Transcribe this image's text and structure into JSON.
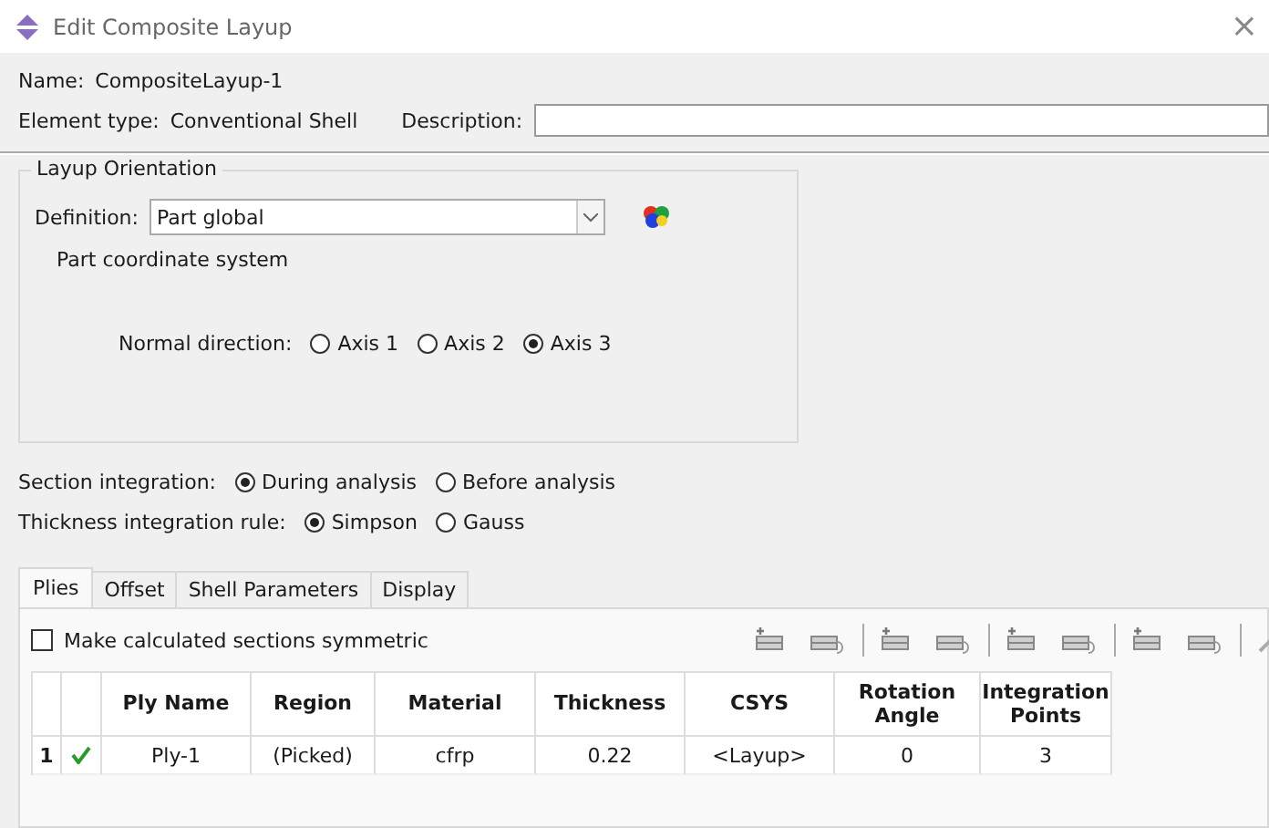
{
  "window": {
    "title": "Edit Composite Layup",
    "close": "×"
  },
  "name": {
    "label": "Name:",
    "value": "CompositeLayup-1"
  },
  "element_type": {
    "label": "Element type:",
    "value": "Conventional Shell"
  },
  "description": {
    "label": "Description:"
  },
  "layup_orientation": {
    "title": "Layup Orientation",
    "definition_label": "Definition:",
    "definition_value": "Part global",
    "note": "Part coordinate system",
    "normal_label": "Normal direction:",
    "normal_options": [
      {
        "label": "Axis 1",
        "selected": false
      },
      {
        "label": "Axis 2",
        "selected": false
      },
      {
        "label": "Axis 3",
        "selected": true
      }
    ]
  },
  "section_integration": {
    "label": "Section integration:",
    "options": [
      {
        "label": "During analysis",
        "selected": true
      },
      {
        "label": "Before analysis",
        "selected": false
      }
    ]
  },
  "thickness_rule": {
    "label": "Thickness integration rule:",
    "options": [
      {
        "label": "Simpson",
        "selected": true
      },
      {
        "label": "Gauss",
        "selected": false
      }
    ]
  },
  "tabs": [
    {
      "label": "Plies",
      "selected": true
    },
    {
      "label": "Offset",
      "selected": false
    },
    {
      "label": "Shell Parameters",
      "selected": false
    },
    {
      "label": "Display",
      "selected": false
    }
  ],
  "symmetric": {
    "label": "Make calculated sections symmetric",
    "checked": false
  },
  "table": {
    "columns": [
      "Ply Name",
      "Region",
      "Material",
      "Thickness",
      "CSYS",
      "Rotation Angle",
      "Integration Points"
    ],
    "rows": [
      {
        "index": "1",
        "active": true,
        "cells": [
          "Ply-1",
          "(Picked)",
          "cfrp",
          "0.22",
          "<Layup>",
          "0",
          "3"
        ]
      }
    ]
  }
}
